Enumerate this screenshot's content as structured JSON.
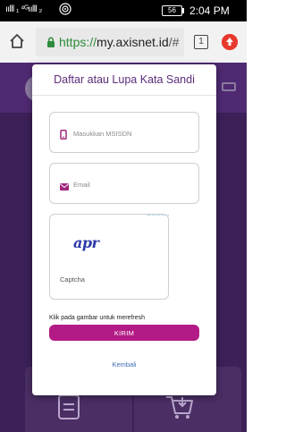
{
  "status_bar": {
    "signal_text": "ıılll ₁ ⁴ᴳıılll ₂",
    "battery": "56",
    "time": "2:04 PM"
  },
  "browser": {
    "url_protocol": "https://",
    "url_host": "my.axisnet.id",
    "url_rest": "/#",
    "tab_count": "1"
  },
  "modal": {
    "title": "Daftar atau Lupa Kata Sandi",
    "msisdn_placeholder": "Masukkan MSISDN",
    "email_placeholder": "Email",
    "captcha_text": "apr",
    "captcha_label": "Captcha",
    "refresh_hint": "Klik pada gambar untuk merefresh",
    "submit_label": "KIRIM",
    "back_label": "Kembali"
  },
  "colors": {
    "primary": "#b31a86",
    "title": "#5a2d7a",
    "page_bg": "#3c2058",
    "link": "#3a6fb0"
  }
}
